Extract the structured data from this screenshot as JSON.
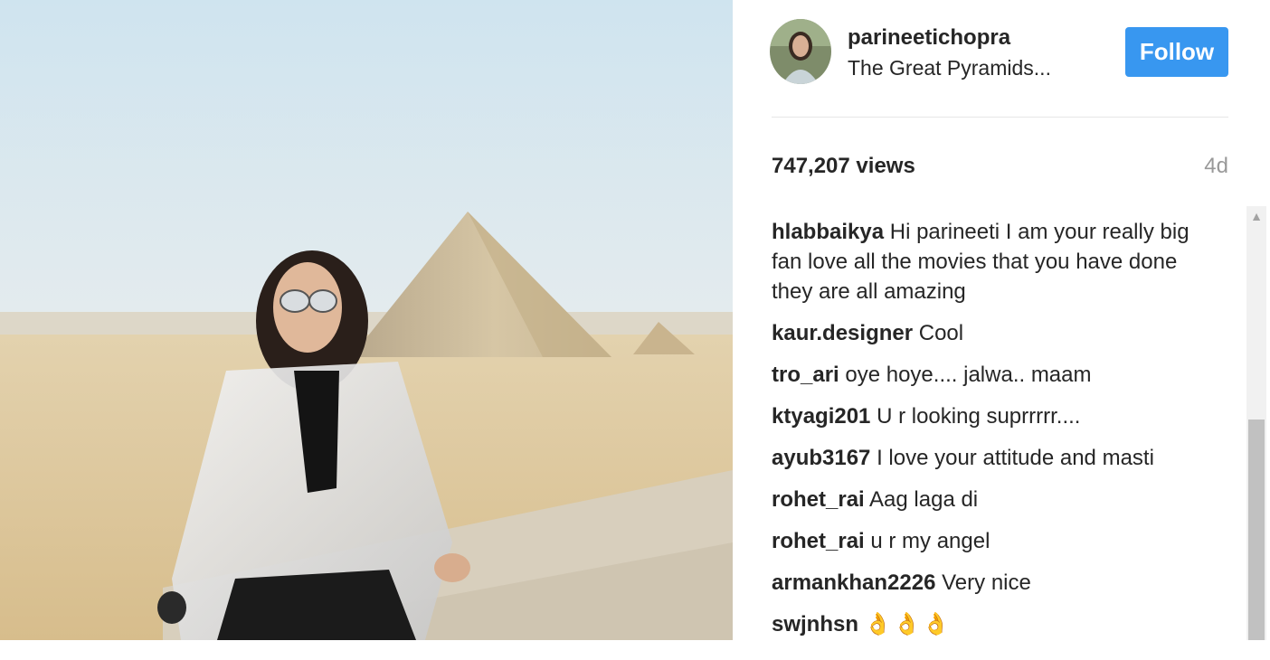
{
  "post": {
    "username": "parineetichopra",
    "location": "The Great Pyramids...",
    "follow_label": "Follow",
    "views": "747,207 views",
    "time_ago": "4d"
  },
  "comments": [
    {
      "author": "hlabbaikya",
      "text": "Hi parineeti I am your really big fan love all the movies that you have done they are all amazing"
    },
    {
      "author": "kaur.designer",
      "text": "Cool"
    },
    {
      "author": "tro_ari",
      "text": "oye hoye.... jalwa.. maam"
    },
    {
      "author": "ktyagi201",
      "text": "U r looking suprrrrr...."
    },
    {
      "author": "ayub3167",
      "text": "I love your attitude and masti"
    },
    {
      "author": "rohet_rai",
      "text": "Aag laga di"
    },
    {
      "author": "rohet_rai",
      "text": "u r my angel"
    },
    {
      "author": "armankhan2226",
      "text": "Very nice"
    },
    {
      "author": "swjnhsn",
      "text": "👌👌👌"
    }
  ],
  "icons": {
    "scroll_up": "chevron-up-icon"
  },
  "colors": {
    "follow_button": "#3897f0",
    "text": "#262626",
    "muted": "#999999",
    "divider": "#e6e6e6"
  }
}
